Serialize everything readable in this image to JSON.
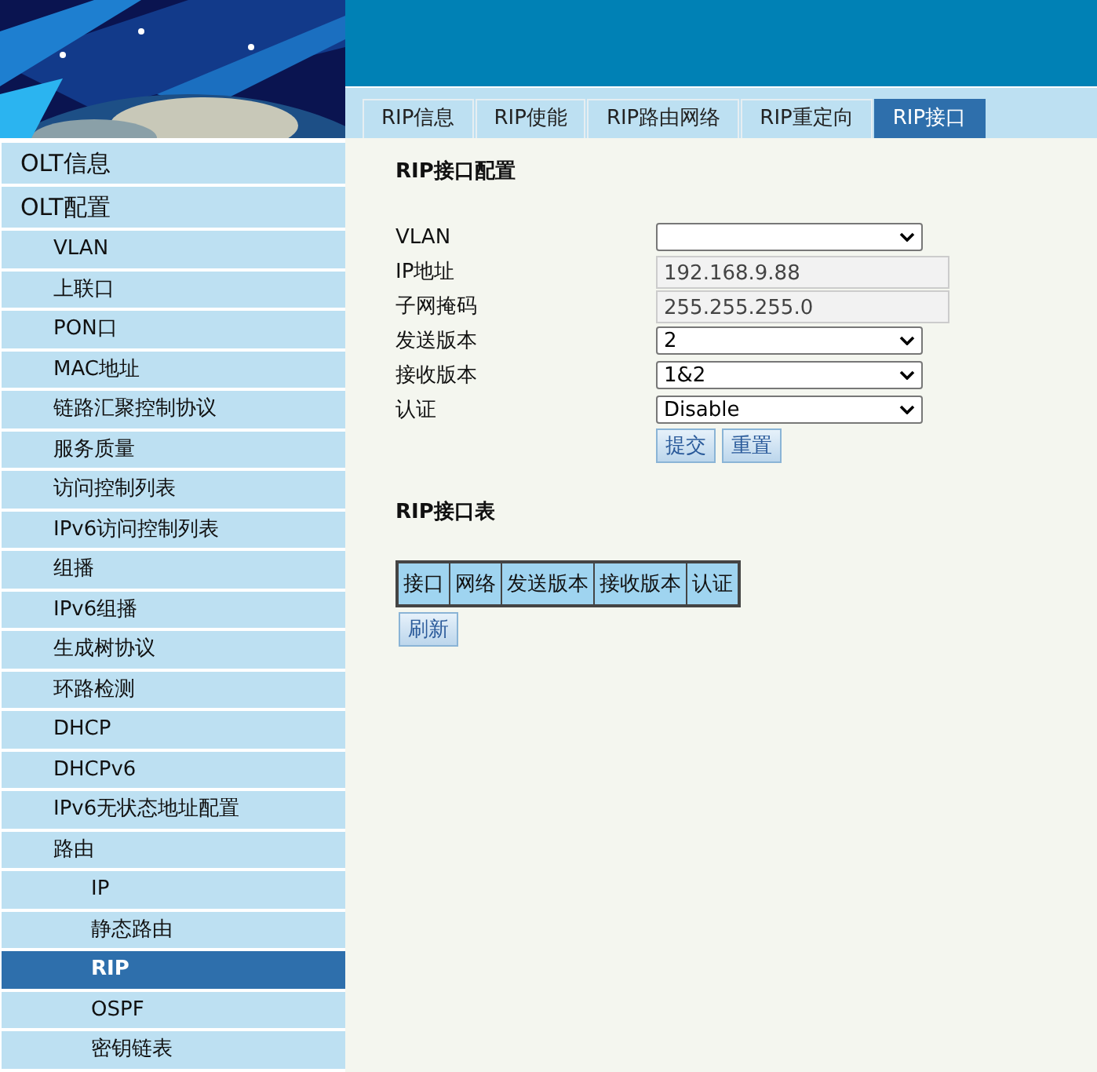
{
  "sidebar": {
    "items": [
      {
        "label": "OLT信息",
        "selected": false
      },
      {
        "label": "OLT配置",
        "selected": false,
        "children": [
          {
            "label": "VLAN",
            "selected": false
          },
          {
            "label": "上联口",
            "selected": false
          },
          {
            "label": "PON口",
            "selected": false
          },
          {
            "label": "MAC地址",
            "selected": false
          },
          {
            "label": "链路汇聚控制协议",
            "selected": false
          },
          {
            "label": "服务质量",
            "selected": false
          },
          {
            "label": "访问控制列表",
            "selected": false
          },
          {
            "label": "IPv6访问控制列表",
            "selected": false
          },
          {
            "label": "组播",
            "selected": false
          },
          {
            "label": "IPv6组播",
            "selected": false
          },
          {
            "label": "生成树协议",
            "selected": false
          },
          {
            "label": "环路检测",
            "selected": false
          },
          {
            "label": "DHCP",
            "selected": false
          },
          {
            "label": "DHCPv6",
            "selected": false
          },
          {
            "label": "IPv6无状态地址配置",
            "selected": false
          },
          {
            "label": "路由",
            "selected": false,
            "children": [
              {
                "label": "IP",
                "selected": false
              },
              {
                "label": "静态路由",
                "selected": false
              },
              {
                "label": "RIP",
                "selected": true
              },
              {
                "label": "OSPF",
                "selected": false
              },
              {
                "label": "密钥链表",
                "selected": false
              }
            ]
          }
        ]
      }
    ]
  },
  "tabs": [
    {
      "label": "RIP信息",
      "selected": false
    },
    {
      "label": "RIP使能",
      "selected": false
    },
    {
      "label": "RIP路由网络",
      "selected": false
    },
    {
      "label": "RIP重定向",
      "selected": false
    },
    {
      "label": "RIP接口",
      "selected": true
    }
  ],
  "form": {
    "title": "RIP接口配置",
    "fields": [
      {
        "label": "VLAN",
        "kind": "select"
      },
      {
        "label": "IP地址",
        "kind": "readonly",
        "value": "192.168.9.88"
      },
      {
        "label": "子网掩码",
        "kind": "readonly",
        "value": "255.255.255.0"
      },
      {
        "label": "发送版本",
        "kind": "select",
        "value": "2"
      },
      {
        "label": "接收版本",
        "kind": "select",
        "value": "1&2"
      },
      {
        "label": "认证",
        "kind": "select",
        "value": "Disable"
      }
    ],
    "buttons": [
      "提交",
      "重置"
    ]
  },
  "table": {
    "title": "RIP接口表",
    "columns": [
      "接口",
      "网络",
      "发送版本",
      "接收版本",
      "认证"
    ],
    "button": "刷新"
  }
}
